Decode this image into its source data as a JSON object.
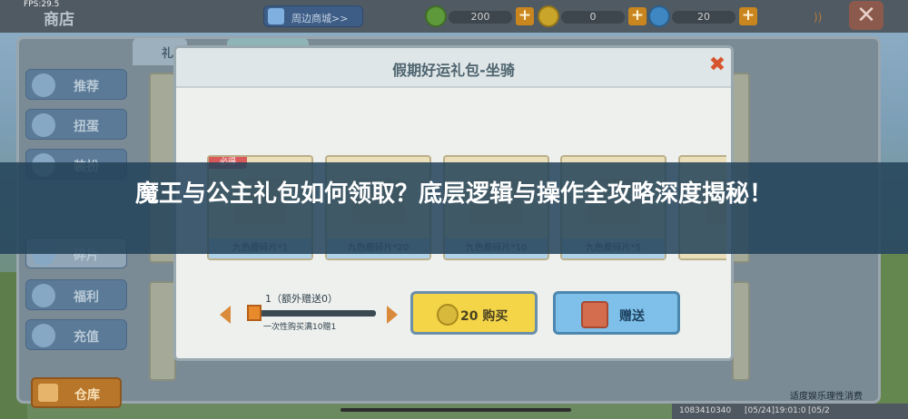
{
  "status": {
    "fps": "FPS:29.5"
  },
  "header": {
    "shop_title": "商店",
    "nearby_mall": "周边商城>>",
    "currencies": [
      {
        "icon": "green-gem-icon",
        "value": "200",
        "color": "#5e9a3c"
      },
      {
        "icon": "gold-coin-icon",
        "value": "0",
        "color": "#c9a52a"
      },
      {
        "icon": "blue-gem-icon",
        "value": "20",
        "color": "#3f87c2"
      }
    ],
    "plus": "+",
    "close": "✕"
  },
  "shop": {
    "tab_first": "礼",
    "sidebar": [
      {
        "label": "推荐",
        "icon": "recommend-icon"
      },
      {
        "label": "扭蛋",
        "icon": "gacha-icon"
      },
      {
        "label": "装扮",
        "icon": "outfit-icon"
      },
      {
        "label": "碎片",
        "icon": "fragment-icon"
      },
      {
        "label": "福利",
        "icon": "welfare-icon"
      },
      {
        "label": "充值",
        "icon": "recharge-icon"
      }
    ],
    "warehouse": "仓库"
  },
  "popup": {
    "title": "假期好运礼包-坐骑",
    "close": "✖",
    "must_badge": "必得",
    "items": [
      {
        "name": "九色鹿碎片*1"
      },
      {
        "name": "九色鹿碎片*20"
      },
      {
        "name": "九色鹿碎片*10"
      },
      {
        "name": "九色鹿碎片*5"
      }
    ],
    "quantity": {
      "value": "1（额外赠送0）",
      "note": "一次性购买满10赠1"
    },
    "buy_label": "20 购买",
    "gift_label": "赠送"
  },
  "footer": {
    "social": "适度娱乐理性消费",
    "uid": "1083410340",
    "time": "[05/24]19:01:0",
    "server": "[05/2"
  },
  "overlay": {
    "title": "魔王与公主礼包如何领取？底层逻辑与操作全攻略深度揭秘！"
  }
}
